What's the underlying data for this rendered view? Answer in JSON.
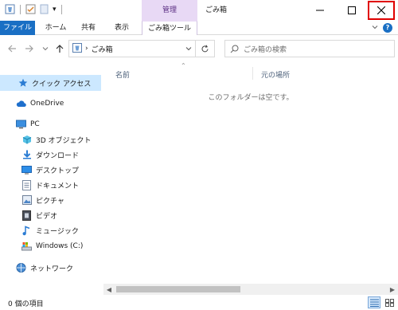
{
  "titlebar": {
    "context_tab": "管理",
    "window_title": "ごみ箱",
    "qat_more": "▾"
  },
  "ribbon": {
    "file_tab": "ファイル",
    "tabs": [
      "ホーム",
      "共有",
      "表示",
      "ごみ箱ツール"
    ]
  },
  "address": {
    "breadcrumb_sep": "›",
    "location": "ごみ箱",
    "search_placeholder": "ごみ箱の検索"
  },
  "nav": {
    "items": [
      {
        "label": "クイック アクセス",
        "icon": "star-icon"
      },
      {
        "label": "OneDrive",
        "icon": "cloud-icon"
      },
      {
        "label": "PC",
        "icon": "computer-icon"
      },
      {
        "label": "3D オブジェクト",
        "icon": "cube-icon"
      },
      {
        "label": "ダウンロード",
        "icon": "download-icon"
      },
      {
        "label": "デスクトップ",
        "icon": "desktop-icon"
      },
      {
        "label": "ドキュメント",
        "icon": "document-icon"
      },
      {
        "label": "ピクチャ",
        "icon": "picture-icon"
      },
      {
        "label": "ビデオ",
        "icon": "video-icon"
      },
      {
        "label": "ミュージック",
        "icon": "music-icon"
      },
      {
        "label": "Windows (C:)",
        "icon": "drive-icon"
      },
      {
        "label": "ネットワーク",
        "icon": "network-icon"
      }
    ]
  },
  "content": {
    "columns": [
      "名前",
      "元の場所"
    ],
    "empty_message": "このフォルダーは空です。"
  },
  "status": {
    "item_count": "0 個の項目"
  },
  "colors": {
    "accent": "#1a6fc4",
    "context_tab": "#e8d9f5",
    "selected": "#cce8ff",
    "close_highlight": "#e00000"
  }
}
